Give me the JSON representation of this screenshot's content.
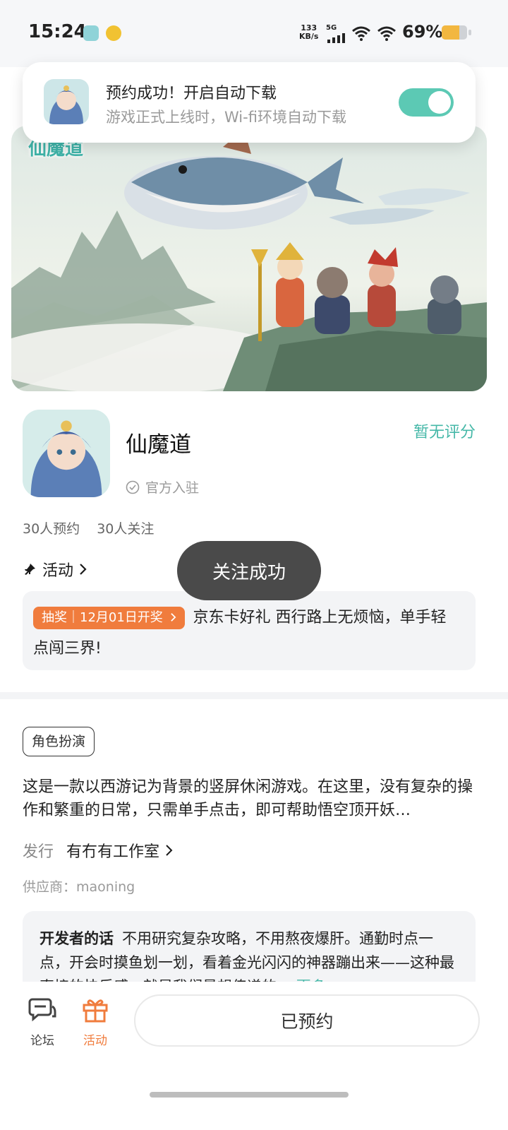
{
  "status_bar": {
    "time": "15:24",
    "net_speed_value": "133",
    "net_speed_unit": "KB/s",
    "network": "5G",
    "battery_percent_text": "69%",
    "battery_level": 0.69,
    "icons": [
      "app-notification-icon",
      "music-icon",
      "signal-icon",
      "wifi-icon",
      "wifi-icon",
      "battery-icon"
    ]
  },
  "notification": {
    "title": "预约成功！开启自动下载",
    "subtitle": "游戏正式上线时，Wi-fi环境自动下载",
    "toggle_on": true,
    "accent": "#5cc9b4"
  },
  "banner": {
    "logo_text": "仙魔道"
  },
  "game": {
    "title": "仙魔道",
    "rating": "暂无评分",
    "official": "官方入驻",
    "reservations": "30人预约",
    "followers": "30人关注"
  },
  "activity": {
    "header": "活动",
    "badge": "抽奖｜12月01日开奖",
    "text": "京东卡好礼 西行路上无烦恼，单手轻点闯三界!"
  },
  "toast": "关注成功",
  "details": {
    "tag": "角色扮演",
    "description": "这是一款以西游记为背景的竖屏休闲游戏。在这里，没有复杂的操作和繁重的日常，只需单手点击，即可帮助悟空顶开妖…",
    "publisher_label": "发行",
    "publisher_name": "有冇有工作室",
    "supplier": "供应商：maoning"
  },
  "developer_note": {
    "title": "开发者的话",
    "text": "不用研究复杂攻略，不用熬夜爆肝。通勤时点一点，开会时摸鱼划一划，看着金光闪闪的神器蹦出来——这种最直接的快乐感，就是我们最想传递的。",
    "more": "更多"
  },
  "bottom_bar": {
    "tab_forum": "论坛",
    "tab_activity": "活动",
    "reserved_button": "已预约"
  },
  "colors": {
    "accent_teal": "#46b8a8",
    "activity_orange": "#f07c3d",
    "toast_bg": "#4a4a4a"
  }
}
